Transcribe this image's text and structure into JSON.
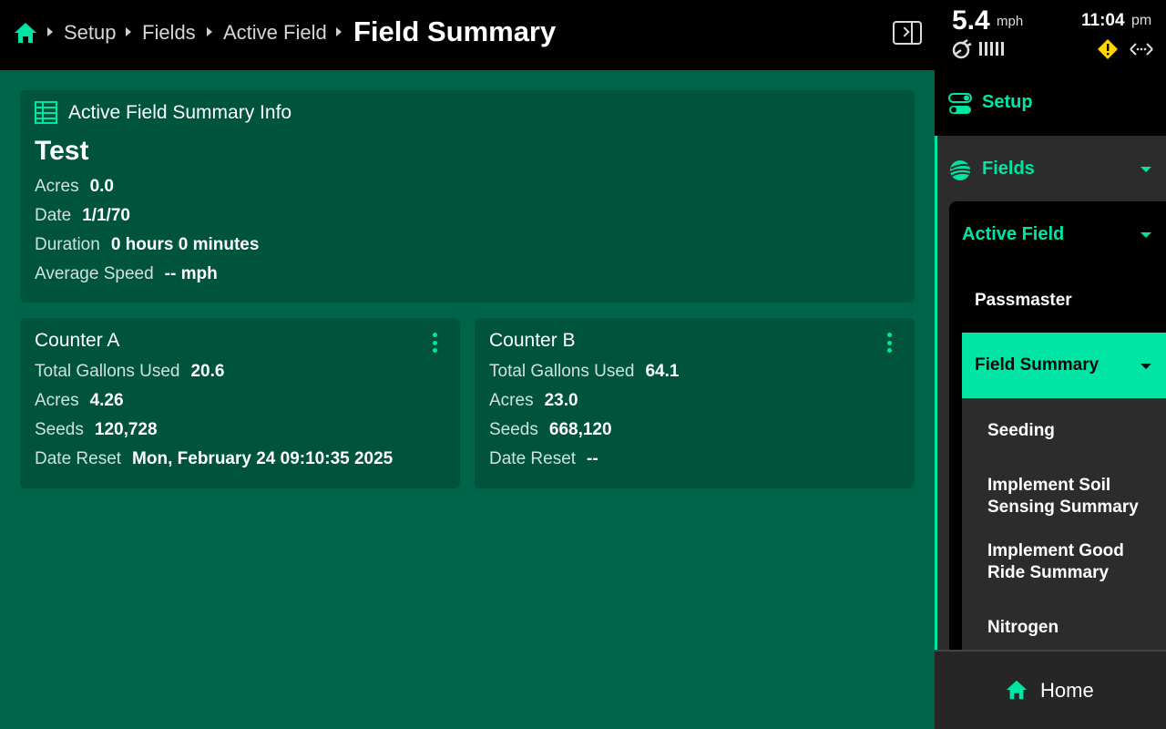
{
  "breadcrumb": {
    "items": [
      "Setup",
      "Fields",
      "Active Field"
    ],
    "current": "Field Summary"
  },
  "status": {
    "speed": "5.4",
    "speed_unit": "mph",
    "time": "11:04",
    "ampm": "pm"
  },
  "summary": {
    "heading": "Active Field Summary Info",
    "field_name": "Test",
    "rows": [
      {
        "label": "Acres",
        "value": "0.0"
      },
      {
        "label": "Date",
        "value": "1/1/70"
      },
      {
        "label": "Duration",
        "value": "0 hours 0 minutes"
      },
      {
        "label": "Average Speed",
        "value": "-- mph"
      }
    ]
  },
  "counters": [
    {
      "title": "Counter A",
      "rows": [
        {
          "label": "Total Gallons Used",
          "value": "20.6"
        },
        {
          "label": "Acres",
          "value": "4.26"
        },
        {
          "label": "Seeds",
          "value": "120,728"
        },
        {
          "label": "Date Reset",
          "value": "Mon, February 24 09:10:35 2025"
        }
      ]
    },
    {
      "title": "Counter B",
      "rows": [
        {
          "label": "Total Gallons Used",
          "value": "64.1"
        },
        {
          "label": "Acres",
          "value": "23.0"
        },
        {
          "label": "Seeds",
          "value": "668,120"
        },
        {
          "label": "Date Reset",
          "value": "--"
        }
      ]
    }
  ],
  "sidebar": {
    "setup": "Setup",
    "fields": "Fields",
    "active_field": "Active Field",
    "passmaster": "Passmaster",
    "field_summary": "Field Summary",
    "sub_items": [
      "Seeding",
      "Implement Soil Sensing Summary",
      "Implement Good Ride Summary",
      "Nitrogen"
    ]
  },
  "home_label": "Home",
  "colors": {
    "accent": "#00e5a3",
    "main_bg": "#006548",
    "card_bg": "#00543b"
  }
}
